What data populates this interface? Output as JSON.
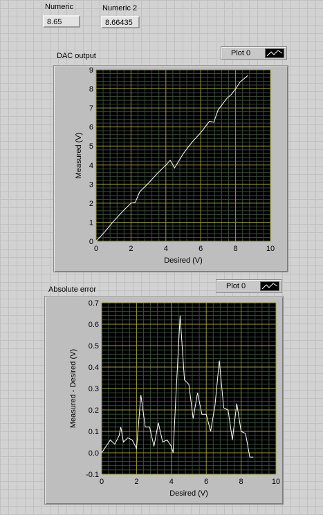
{
  "controls": {
    "numeric_label": "Numeric",
    "numeric_value": "8.65",
    "numeric2_label": "Numeric 2",
    "numeric2_value": "8.66435"
  },
  "graphs": [
    {
      "title": "DAC output",
      "legend_label": "Plot 0",
      "xlabel": "Desired (V)",
      "ylabel": "Measured (V)"
    },
    {
      "title": "Absolute error",
      "legend_label": "Plot 0",
      "xlabel": "Desired (V)",
      "ylabel": "Measured - Desired (V)"
    }
  ],
  "chart_data": [
    {
      "type": "line",
      "title": "DAC output",
      "xlabel": "Desired (V)",
      "ylabel": "Measured (V)",
      "xlim": [
        0,
        10
      ],
      "ylim": [
        0,
        9
      ],
      "xticks": [
        0,
        2,
        4,
        6,
        8,
        10
      ],
      "yticks": [
        0,
        1,
        2,
        3,
        4,
        5,
        6,
        7,
        8,
        9
      ],
      "grid": true,
      "series": [
        {
          "name": "Plot 0",
          "color": "#ffffff",
          "x": [
            0,
            0.5,
            1.0,
            1.5,
            2.0,
            2.25,
            2.5,
            3.0,
            3.5,
            4.0,
            4.25,
            4.5,
            5.0,
            5.5,
            6.0,
            6.5,
            6.75,
            7.0,
            7.5,
            7.75,
            8.0,
            8.25,
            8.7
          ],
          "y": [
            0,
            0.5,
            1.05,
            1.55,
            2.0,
            2.05,
            2.6,
            3.05,
            3.55,
            4.0,
            4.25,
            3.85,
            4.6,
            5.2,
            5.7,
            6.3,
            6.25,
            6.9,
            7.5,
            7.7,
            8.0,
            8.35,
            8.7
          ]
        }
      ]
    },
    {
      "type": "line",
      "title": "Absolute error",
      "xlabel": "Desired (V)",
      "ylabel": "Measured - Desired (V)",
      "xlim": [
        0,
        10
      ],
      "ylim": [
        -0.1,
        0.7
      ],
      "xticks": [
        0,
        2,
        4,
        6,
        8,
        10
      ],
      "yticks": [
        -0.1,
        0,
        0.1,
        0.2,
        0.3,
        0.4,
        0.5,
        0.6,
        0.7
      ],
      "grid": true,
      "series": [
        {
          "name": "Plot 0",
          "color": "#ffffff",
          "x": [
            0,
            0.25,
            0.5,
            0.75,
            1.0,
            1.1,
            1.25,
            1.5,
            1.75,
            2.0,
            2.25,
            2.5,
            2.75,
            3.0,
            3.25,
            3.5,
            3.75,
            4.0,
            4.1,
            4.25,
            4.5,
            4.75,
            5.0,
            5.25,
            5.5,
            5.75,
            6.0,
            6.25,
            6.5,
            6.75,
            7.0,
            7.25,
            7.5,
            7.75,
            8.0,
            8.25,
            8.5,
            8.7
          ],
          "y": [
            0,
            0.03,
            0.06,
            0.04,
            0.08,
            0.12,
            0.05,
            0.07,
            0.06,
            0.02,
            0.27,
            0.12,
            0.12,
            0.03,
            0.14,
            0.05,
            0.06,
            0.03,
            0.0,
            0.25,
            0.64,
            0.34,
            0.32,
            0.16,
            0.28,
            0.18,
            0.18,
            0.1,
            0.22,
            0.43,
            0.21,
            0.2,
            0.06,
            0.23,
            0.1,
            0.09,
            -0.02,
            -0.02
          ]
        }
      ]
    }
  ]
}
